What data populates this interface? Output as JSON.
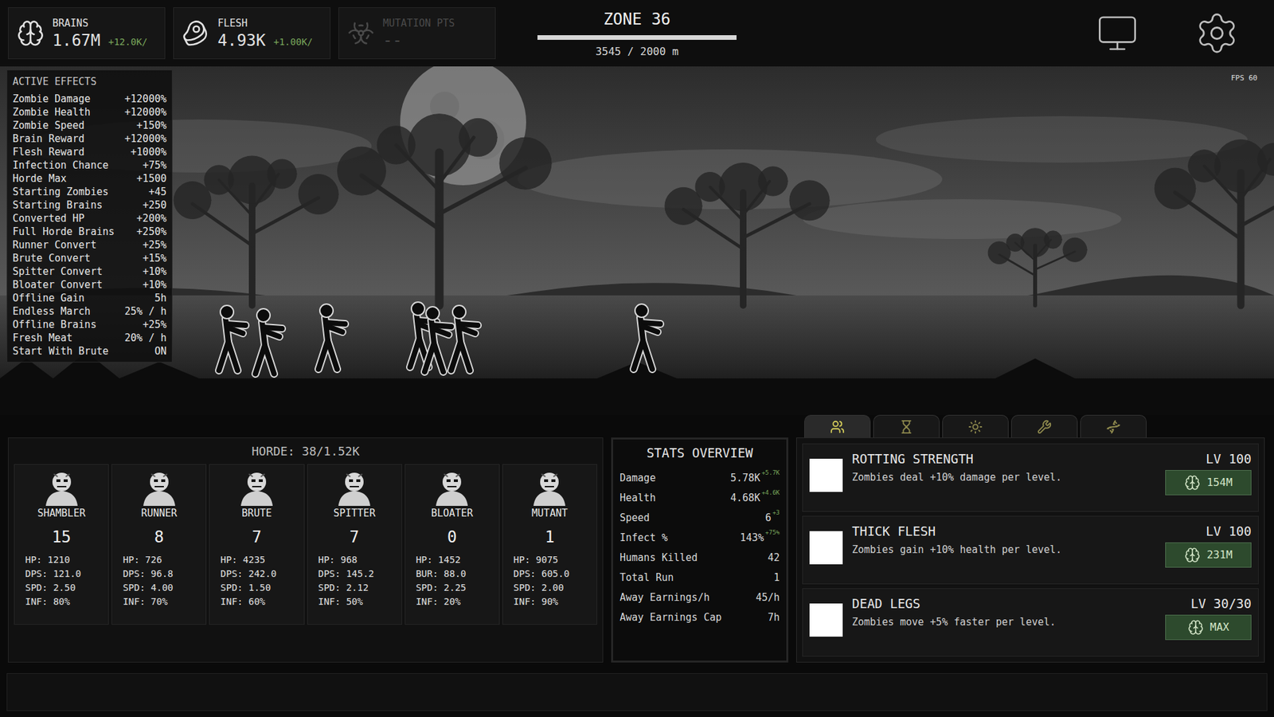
{
  "resources": [
    {
      "label": "BRAINS",
      "value": "1.67M",
      "rate": "+12.0K/",
      "disabled": false
    },
    {
      "label": "FLESH",
      "value": "4.93K",
      "rate": "+1.00K/",
      "disabled": false
    },
    {
      "label": "MUTATION PTS",
      "value": "--",
      "disabled": true
    }
  ],
  "zone": {
    "title": "ZONE 36",
    "progress": "3545 / 2000 m",
    "level": 1
  },
  "fps": "FPS 60",
  "active_effects": {
    "title": "ACTIVE EFFECTS",
    "items": [
      {
        "label": "Zombie Damage",
        "value": "+12000%"
      },
      {
        "label": "Zombie Health",
        "value": "+12000%"
      },
      {
        "label": "Zombie Speed",
        "value": "+150%"
      },
      {
        "label": "Brain Reward",
        "value": "+12000%"
      },
      {
        "label": "Flesh Reward",
        "value": "+1000%"
      },
      {
        "label": "Infection Chance",
        "value": "+75%"
      },
      {
        "label": "Horde Max",
        "value": "+1500"
      },
      {
        "label": "Starting Zombies",
        "value": "+45"
      },
      {
        "label": "Starting Brains",
        "value": "+250"
      },
      {
        "label": "Converted HP",
        "value": "+200%"
      },
      {
        "label": "Full Horde Brains",
        "value": "+250%"
      },
      {
        "label": "Runner Convert",
        "value": "+25%"
      },
      {
        "label": "Brute Convert",
        "value": "+15%"
      },
      {
        "label": "Spitter Convert",
        "value": "+10%"
      },
      {
        "label": "Bloater Convert",
        "value": "+10%"
      },
      {
        "label": "Offline Gain",
        "value": "5h"
      },
      {
        "label": "Endless March",
        "value": "25% / h"
      },
      {
        "label": "Offline Brains",
        "value": "+25%"
      },
      {
        "label": "Fresh Meat",
        "value": "20% / h"
      },
      {
        "label": "Start With Brute",
        "value": "ON"
      }
    ]
  },
  "horde": {
    "title": "HORDE: 38/1.52K",
    "units": [
      {
        "name": "SHAMBLER",
        "count": "15",
        "stats": [
          "HP: 1210",
          "DPS: 121.0",
          "SPD: 2.50",
          "INF: 80%"
        ]
      },
      {
        "name": "RUNNER",
        "count": "8",
        "stats": [
          "HP: 726",
          "DPS: 96.8",
          "SPD: 4.00",
          "INF: 70%"
        ]
      },
      {
        "name": "BRUTE",
        "count": "7",
        "stats": [
          "HP: 4235",
          "DPS: 242.0",
          "SPD: 1.50",
          "INF: 60%"
        ]
      },
      {
        "name": "SPITTER",
        "count": "7",
        "stats": [
          "HP: 968",
          "DPS: 145.2",
          "SPD: 2.12",
          "INF: 50%"
        ]
      },
      {
        "name": "BLOATER",
        "count": "0",
        "stats": [
          "HP: 1452",
          "BUR: 88.0",
          "SPD: 2.25",
          "INF: 20%"
        ]
      },
      {
        "name": "MUTANT",
        "count": "1",
        "stats": [
          "HP: 9075",
          "DPS: 605.0",
          "SPD: 2.00",
          "INF: 90%"
        ]
      }
    ]
  },
  "stats_overview": {
    "title": "STATS OVERVIEW",
    "rows": [
      {
        "label": "Damage",
        "value": "5.78K",
        "delta": "+5.7K"
      },
      {
        "label": "Health",
        "value": "4.68K",
        "delta": "+4.6K"
      },
      {
        "label": "Speed",
        "value": "6",
        "delta": "+3"
      },
      {
        "label": "Infect %",
        "value": "143%",
        "delta": "+75%"
      },
      {
        "label": "Humans Killed",
        "value": "42"
      },
      {
        "label": "Total Run",
        "value": "1"
      },
      {
        "label": "Away Earnings/h",
        "value": "45/h"
      },
      {
        "label": "Away Earnings Cap",
        "value": "7h"
      }
    ]
  },
  "upgrade_tabs": [
    {
      "selected": true
    },
    {
      "selected": false
    },
    {
      "selected": false
    },
    {
      "selected": false
    },
    {
      "selected": false
    }
  ],
  "upgrades": [
    {
      "name": "ROTTING STRENGTH",
      "level": "LV 100",
      "description": "Zombies deal +10% damage per level.",
      "cost": "154M"
    },
    {
      "name": "THICK FLESH",
      "level": "LV 100",
      "description": "Zombies gain +10% health per level.",
      "cost": "231M"
    },
    {
      "name": "DEAD LEGS",
      "level": "LV 30/30",
      "description": "Zombies move +5% faster per level.",
      "cost": "MAX"
    }
  ]
}
